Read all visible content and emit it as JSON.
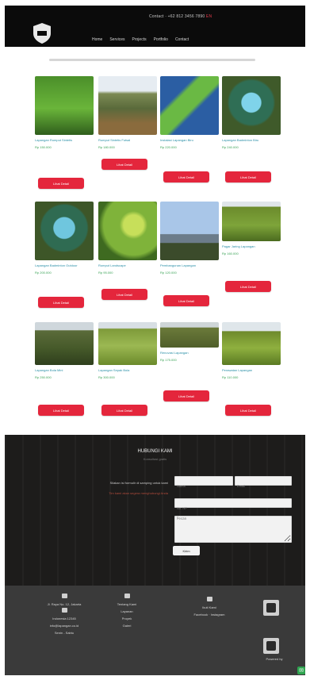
{
  "header": {
    "logo_name": "shield-logo",
    "topbar_text": "Contact · +62 812 3456 7890",
    "topbar_red": "EN",
    "nav": [
      "Home",
      "Services",
      "Projects",
      "Portfolio",
      "Contact"
    ]
  },
  "products": {
    "row1": [
      {
        "title": "Lapangan Rumput Sintetis",
        "price": "Rp 150.000",
        "btn": "Lihat Detail"
      },
      {
        "title": "Rumput Sintetis Futsal",
        "price": "Rp 180.000",
        "btn": "Lihat Detail"
      },
      {
        "title": "Instalasi Lapangan Biru",
        "price": "Rp 220.000",
        "btn": "Lihat Detail"
      },
      {
        "title": "Lapangan Badminton Biru",
        "price": "Rp 240.000",
        "btn": "Lihat Detail"
      }
    ],
    "row2": [
      {
        "title": "Lapangan Badminton Outdoor",
        "price": "Rp 200.000",
        "btn": "Lihat Detail"
      },
      {
        "title": "Rumput Landscape",
        "price": "Rp 95.000",
        "btn": "Lihat Detail"
      },
      {
        "title": "Pembangunan Lapangan",
        "price": "Rp 120.000",
        "btn": "Lihat Detail"
      },
      {
        "title": "Pagar Jaring Lapangan",
        "price": "Rp 160.000",
        "btn": "Lihat Detail"
      }
    ],
    "row3": [
      {
        "title": "Lapangan Bola Mini",
        "price": "Rp 250.000",
        "btn": "Lihat Detail"
      },
      {
        "title": "Lapangan Sepak Bola",
        "price": "Rp 300.000",
        "btn": "Lihat Detail"
      },
      {
        "title": "Renovasi Lapangan",
        "price": "Rp 175.000",
        "btn": "Lihat Detail"
      },
      {
        "title": "Perawatan Lapangan",
        "price": "Rp 110.000",
        "btn": "Lihat Detail"
      }
    ]
  },
  "contact": {
    "title": "HUBUNGI KAMI",
    "subtitle": "Konsultasi gratis",
    "left_line1": "Silakan isi formulir di samping untuk kami",
    "left_line2": "Tim kami akan segera menghubungi Anda",
    "name_placeholder": "Nama",
    "email_placeholder": "Email",
    "phone_placeholder": "No. HP",
    "message_placeholder": "Pesan",
    "send_label": "Kirim"
  },
  "footer": {
    "col1": [
      "Jl. Raya No. 12, Jakarta",
      "Indonesia 12345",
      "info@lapangan.co.id",
      "Senin - Sabtu"
    ],
    "col2": [
      "Tentang Kami",
      "Layanan",
      "Proyek",
      "Galeri"
    ],
    "col3": [
      "Ikuti Kami",
      "Facebook · Instagram"
    ],
    "col4_caption": "Powered by"
  },
  "colors": {
    "accent_red": "#e4263c",
    "link_teal": "#2a8fa7",
    "price_green": "#3aa356",
    "dark": "#0b0b0b"
  }
}
